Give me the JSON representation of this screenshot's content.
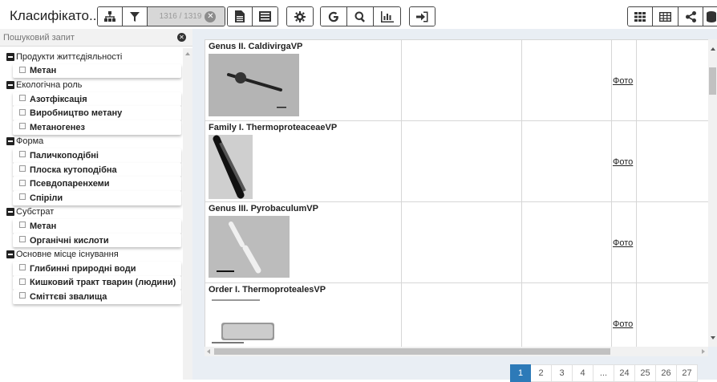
{
  "app": {
    "title": "Класифікато..."
  },
  "toolbar": {
    "filter_count": "1316 / 1319",
    "icons": [
      "sitemap-icon",
      "filter-icon",
      "clear-filter-icon",
      "document-icon",
      "list-icon",
      "gear-icon",
      "google-icon",
      "search-icon",
      "bar-chart-icon",
      "sign-in-icon",
      "grid-icon",
      "table-icon",
      "share-icon",
      "database-icon"
    ]
  },
  "search": {
    "placeholder": "Пошуковий запит"
  },
  "sidebar": {
    "groups": [
      {
        "label": "Продукти життєдіяльності",
        "items": [
          "Метан"
        ]
      },
      {
        "label": "Екологічна роль",
        "items": [
          "Азотфіксація",
          "Виробництво метану",
          "Метаногенез"
        ]
      },
      {
        "label": "Форма",
        "items": [
          "Паличкоподібні",
          "Плоска кутоподібна",
          "Псевдопаренхеми",
          "Спіріли"
        ]
      },
      {
        "label": "Субстрат",
        "items": [
          "Метан",
          "Органічні кислоти"
        ]
      },
      {
        "label": "Основне місце існування",
        "items": [
          "Глибинні природні води",
          "Кишковий тракт тварин (людини)",
          "Сміттєві звалища"
        ]
      }
    ]
  },
  "table": {
    "rows": [
      {
        "title": "Genus II. CaldivirgaVP",
        "link": "Фото"
      },
      {
        "title": "Family I. ThermoproteaceaeVP",
        "link": "Фото"
      },
      {
        "title": "Genus III. PyrobaculumVP",
        "link": "Фото"
      },
      {
        "title": "Order I. ThermoprotealesVP",
        "link": "Фото"
      }
    ]
  },
  "pagination": {
    "pages": [
      "1",
      "2",
      "3",
      "4",
      "...",
      "24",
      "25",
      "26",
      "27"
    ],
    "active": "1"
  },
  "colors": {
    "accent": "#2d7ab8",
    "background": "#e9eef4"
  }
}
